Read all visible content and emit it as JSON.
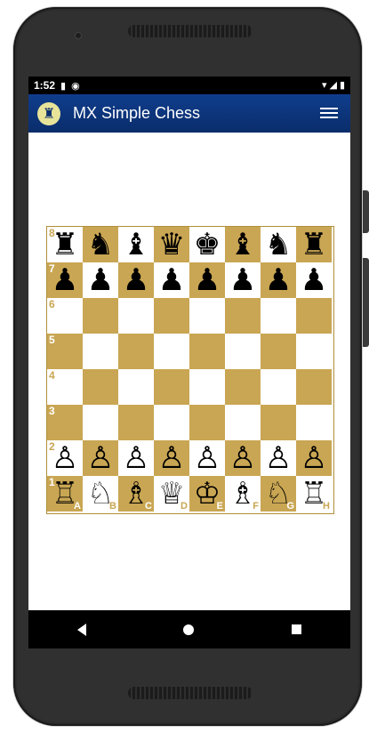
{
  "status_bar": {
    "time": "1:52"
  },
  "app_bar": {
    "title": "MX Simple Chess"
  },
  "board": {
    "colors": {
      "light": "#ffffff",
      "dark": "#c9a653"
    },
    "rows": [
      [
        "♜",
        "♞",
        "♝",
        "♛",
        "♚",
        "♝",
        "♞",
        "♜"
      ],
      [
        "♟",
        "♟",
        "♟",
        "♟",
        "♟",
        "♟",
        "♟",
        "♟"
      ],
      [
        "",
        "",
        "",
        "",
        "",
        "",
        "",
        ""
      ],
      [
        "",
        "",
        "",
        "",
        "",
        "",
        "",
        ""
      ],
      [
        "",
        "",
        "",
        "",
        "",
        "",
        "",
        ""
      ],
      [
        "",
        "",
        "",
        "",
        "",
        "",
        "",
        ""
      ],
      [
        "♙",
        "♙",
        "♙",
        "♙",
        "♙",
        "♙",
        "♙",
        "♙"
      ],
      [
        "♖",
        "♘",
        "♗",
        "♕",
        "♔",
        "♗",
        "♘",
        "♖"
      ]
    ],
    "rank_labels": [
      "8",
      "7",
      "6",
      "5",
      "4",
      "3",
      "2",
      "1"
    ],
    "file_labels": [
      "A",
      "B",
      "C",
      "D",
      "E",
      "F",
      "G",
      "H"
    ]
  }
}
